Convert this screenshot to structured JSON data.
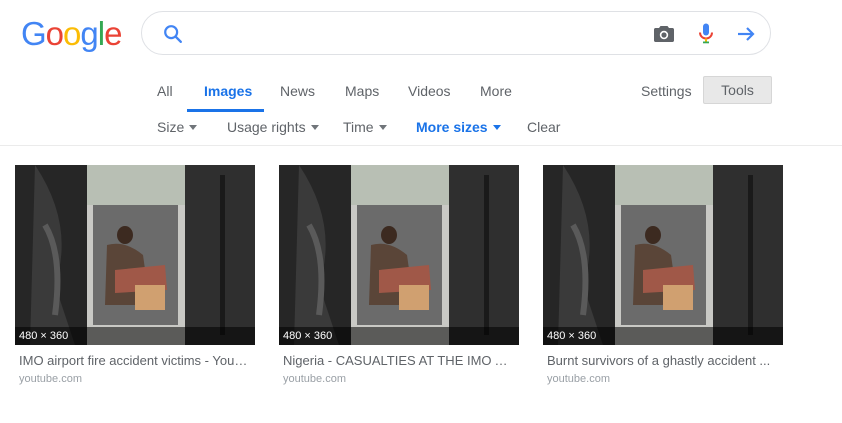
{
  "logo": {
    "letters": [
      "G",
      "o",
      "o",
      "g",
      "l",
      "e"
    ],
    "colors": [
      "#4285f4",
      "#ea4335",
      "#fbbc05",
      "#4285f4",
      "#34a853",
      "#ea4335"
    ]
  },
  "search": {
    "value": "",
    "placeholder": ""
  },
  "tabs": [
    {
      "label": "All"
    },
    {
      "label": "Images"
    },
    {
      "label": "News"
    },
    {
      "label": "Maps"
    },
    {
      "label": "Videos"
    },
    {
      "label": "More"
    }
  ],
  "settings_label": "Settings",
  "tools_label": "Tools",
  "filters": [
    {
      "label": "Size"
    },
    {
      "label": "Usage rights"
    },
    {
      "label": "Time"
    },
    {
      "label": "More sizes"
    },
    {
      "label": "Clear"
    }
  ],
  "results": [
    {
      "dims": "480 × 360",
      "title": "IMO airport fire accident victims - YouT...",
      "source": "youtube.com"
    },
    {
      "dims": "480 × 360",
      "title": "Nigeria - CASUALTIES AT THE IMO AI...",
      "source": "youtube.com"
    },
    {
      "dims": "480 × 360",
      "title": "Burnt survivors of a ghastly accident ...",
      "source": "youtube.com"
    }
  ],
  "colors": {
    "accent": "#1a73e8",
    "tab_text": "#5f6368"
  }
}
